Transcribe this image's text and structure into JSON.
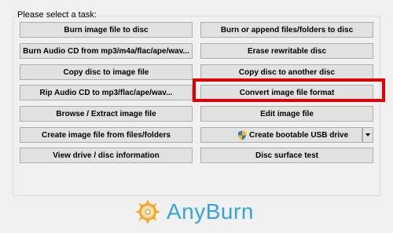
{
  "group_label": "Please select a task:",
  "buttons": {
    "burn_image": "Burn image file to disc",
    "burn_append": "Burn or append files/folders to disc",
    "burn_audio": "Burn Audio CD from mp3/m4a/flac/ape/wav...",
    "erase": "Erase rewritable disc",
    "copy_to_image": "Copy disc to image file",
    "copy_to_disc": "Copy disc to another disc",
    "rip_audio": "Rip Audio CD to mp3/flac/ape/wav...",
    "convert": "Convert image file format",
    "browse_extract": "Browse / Extract image file",
    "edit_image": "Edit image file",
    "create_image": "Create image file from files/folders",
    "create_usb": "Create bootable USB drive",
    "view_drive": "View drive / disc information",
    "surface_test": "Disc surface test"
  },
  "logo_text": "AnyBurn",
  "colors": {
    "highlight": "#e00000",
    "brand": "#36a4e0",
    "button_bg": "#e1e1e1"
  }
}
